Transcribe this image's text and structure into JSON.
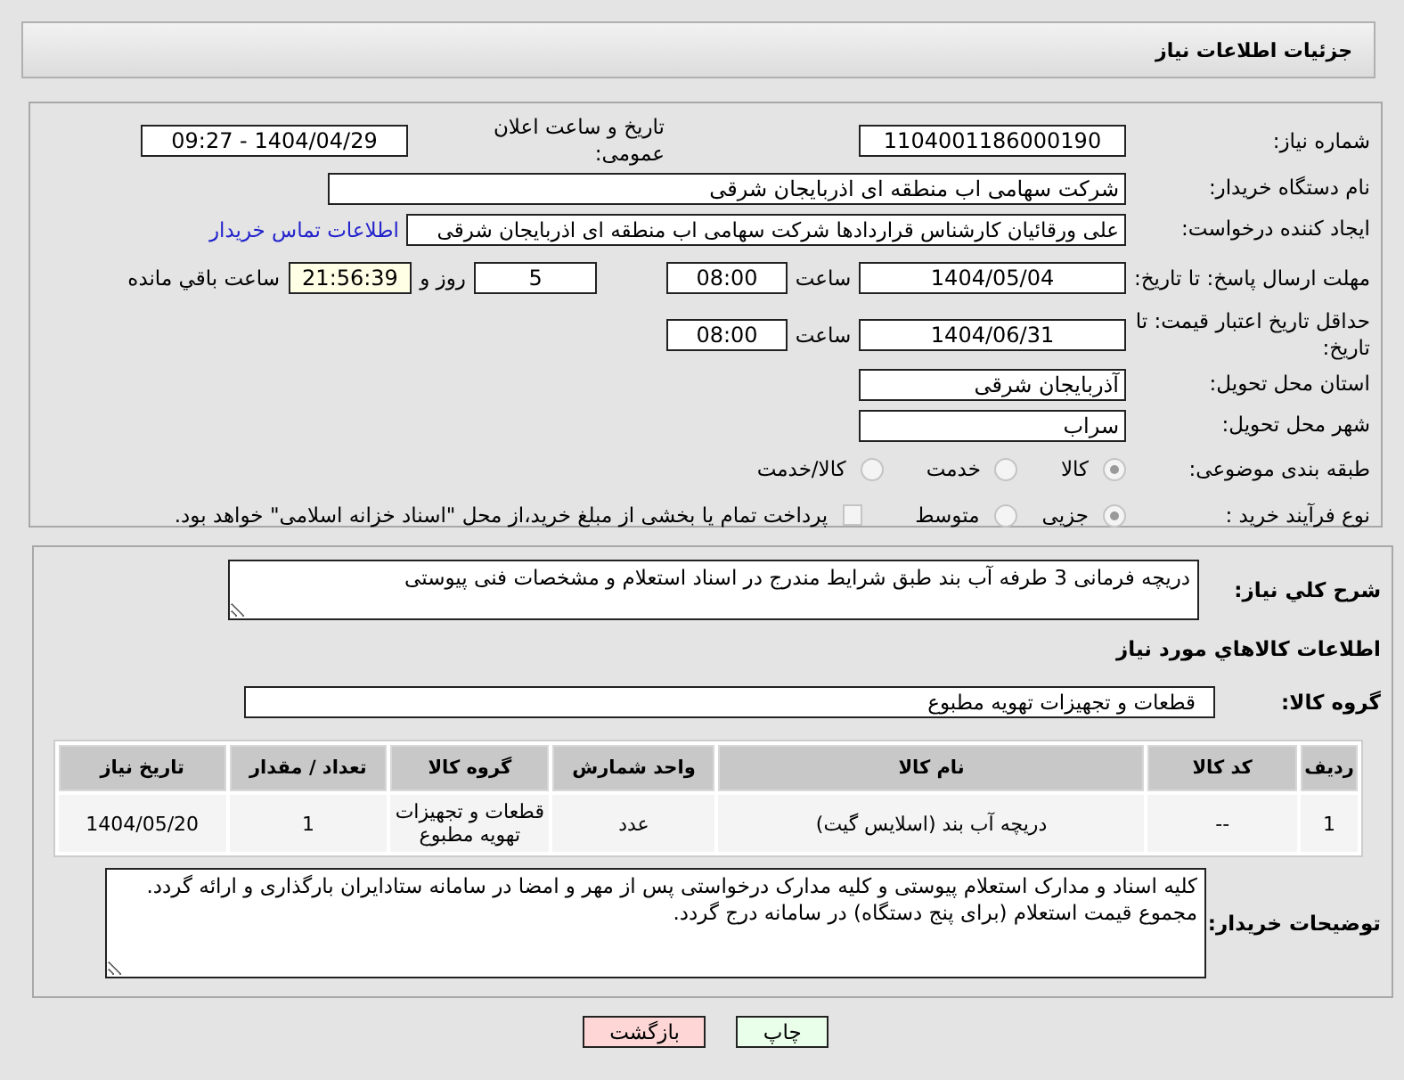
{
  "header": {
    "title": "جزئیات اطلاعات نیاز"
  },
  "form": {
    "need_number": {
      "label": "شماره نیاز:",
      "value": "1104001186000190"
    },
    "announce": {
      "label": "تاریخ و ساعت اعلان عمومی:",
      "value": "1404/04/29 - 09:27"
    },
    "buyer": {
      "label": "نام دستگاه خریدار:",
      "value": "شرکت سهامی اب منطقه ای اذربایجان شرقی"
    },
    "creator": {
      "label": "ایجاد کننده درخواست:",
      "value": "علی ورقائیان کارشناس قراردادها شرکت سهامی اب منطقه ای اذربایجان شرقی",
      "link": "اطلاعات تماس خریدار"
    },
    "deadline": {
      "label": "مهلت ارسال پاسخ: تا تاریخ:",
      "date": "1404/05/04",
      "time_label": "ساعت",
      "time": "08:00",
      "days": "5",
      "days_label": "روز و",
      "remaining": "21:56:39",
      "remaining_label": "ساعت باقي مانده"
    },
    "validity": {
      "label": "حداقل تاریخ اعتبار قیمت: تا تاریخ:",
      "date": "1404/06/31",
      "time_label": "ساعت",
      "time": "08:00"
    },
    "province": {
      "label": "استان محل تحویل:",
      "value": "آذربایجان شرقی"
    },
    "city": {
      "label": "شهر محل تحویل:",
      "value": "سراب"
    },
    "category": {
      "label": "طبقه بندی موضوعی:",
      "options": [
        {
          "label": "کالا",
          "selected": true
        },
        {
          "label": "خدمت",
          "selected": false
        },
        {
          "label": "کالا/خدمت",
          "selected": false
        }
      ]
    },
    "process": {
      "label": "نوع فرآیند خرید :",
      "options": [
        {
          "label": "جزیی",
          "selected": true
        },
        {
          "label": "متوسط",
          "selected": false
        }
      ],
      "treasury": {
        "label": "پرداخت تمام یا بخشی از مبلغ خرید،از محل \"اسناد خزانه اسلامی\" خواهد بود.",
        "checked": false
      }
    }
  },
  "details": {
    "description": {
      "label": "شرح کلي نیاز:",
      "value": "دریچه فرمانی 3 طرفه آب بند طبق شرایط مندرج در اسناد استعلام و مشخصات فنی پیوستی"
    },
    "goods_title": "اطلاعات کالاهاي مورد نیاز",
    "group": {
      "label": "گروه کالا:",
      "value": "قطعات و تجهیزات تهویه مطبوع"
    },
    "table": {
      "columns": [
        "ردیف",
        "کد کالا",
        "نام کالا",
        "واحد شمارش",
        "گروه کالا",
        "تعداد / مقدار",
        "تاریخ نیاز"
      ],
      "rows": [
        [
          "1",
          "--",
          "دریچه آب بند (اسلایس گیت)",
          "عدد",
          "قطعات و تجهیزات تهویه مطبوع",
          "1",
          "1404/05/20"
        ]
      ]
    },
    "notes": {
      "label": "توضیحات خریدار:",
      "value": "کلیه اسناد و مدارک استعلام پیوستی و کلیه مدارک درخواستی پس از مهر و امضا در سامانه ستادایران بارگذاری و ارائه گردد.\nمجموع قیمت استعلام (برای پنج دستگاه) در سامانه درج گردد."
    }
  },
  "buttons": [
    {
      "label": "چاپ",
      "kind": "print"
    },
    {
      "label": "بازگشت",
      "kind": "back"
    }
  ]
}
